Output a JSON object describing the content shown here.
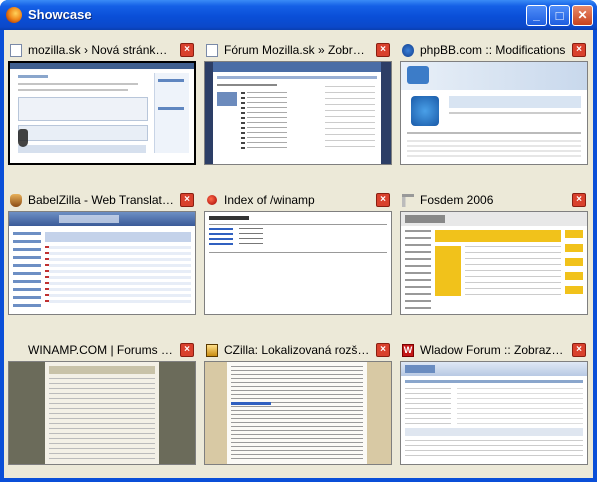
{
  "window": {
    "title": "Showcase",
    "minimize": "_",
    "maximize": "□",
    "close": "✕"
  },
  "tiles": [
    {
      "title": "mozilla.sk › Nová stránka ...",
      "favicon": "page-icon",
      "selected": true
    },
    {
      "title": "Fórum Mozilla.sk » Zobrazi...",
      "favicon": "page-icon",
      "selected": false
    },
    {
      "title": "phpBB.com :: Modifications",
      "favicon": "phpbb-icon",
      "selected": false
    },
    {
      "title": "BabelZilla - Web Translatio...",
      "favicon": "babelzilla-icon",
      "selected": false
    },
    {
      "title": "Index of /winamp",
      "favicon": "red-dot-icon",
      "selected": false
    },
    {
      "title": "Fosdem 2006",
      "favicon": "fosdem-icon",
      "selected": false
    },
    {
      "title": "WINAMP.COM | Forums - ...",
      "favicon": "",
      "selected": false
    },
    {
      "title": "CZilla: Lokalizovaná rozšíre...",
      "favicon": "czilla-icon",
      "selected": false
    },
    {
      "title": "Wladow Forum :: Zobraziť ...",
      "favicon": "wladow-icon",
      "selected": false
    }
  ],
  "close_label": "×",
  "wladow_letter": "W"
}
